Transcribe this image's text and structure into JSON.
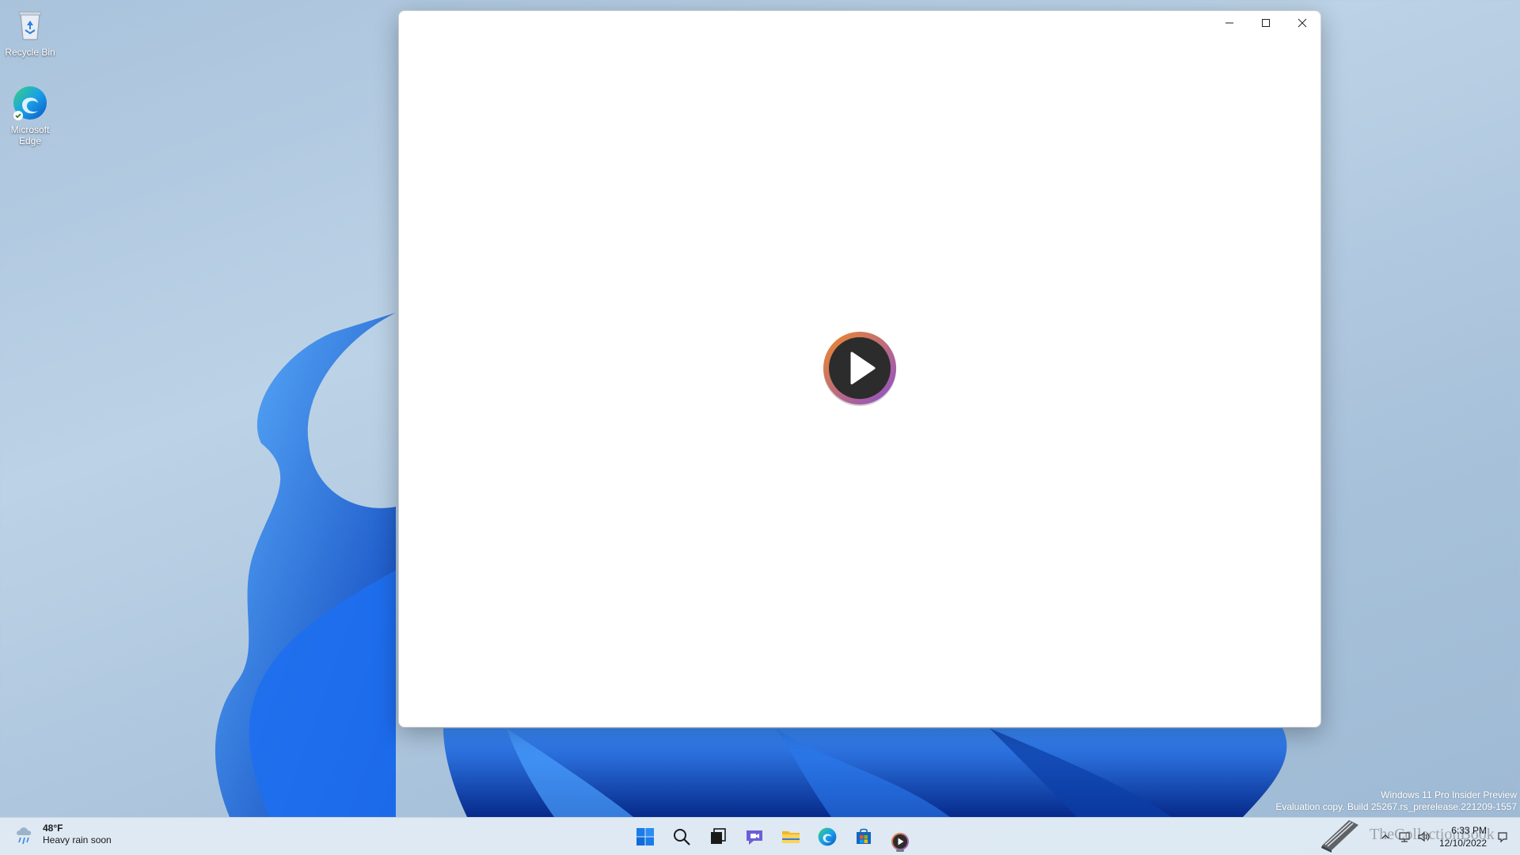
{
  "desktop": {
    "icons": [
      {
        "label": "Recycle Bin",
        "icon": "recycle-bin-icon"
      },
      {
        "label": "Microsoft Edge",
        "icon": "edge-icon"
      }
    ]
  },
  "window": {
    "controls": {
      "minimize": "minimize-icon",
      "maximize": "maximize-icon",
      "close": "close-icon"
    },
    "logo": "play-logo-icon"
  },
  "watermark": {
    "line1": "Windows 11 Pro Insider Preview",
    "line2": "Evaluation copy. Build 25267.rs_prerelease.221209-1557"
  },
  "taskbar": {
    "weather": {
      "temp": "48°F",
      "condition": "Heavy rain soon",
      "icon": "rain-cloud-icon"
    },
    "pinned": [
      {
        "name": "start",
        "icon": "windows-start-icon"
      },
      {
        "name": "search",
        "icon": "search-icon"
      },
      {
        "name": "task-view",
        "icon": "task-view-icon"
      },
      {
        "name": "chat",
        "icon": "chat-icon"
      },
      {
        "name": "file-explorer",
        "icon": "folder-icon"
      },
      {
        "name": "edge",
        "icon": "edge-icon"
      },
      {
        "name": "store",
        "icon": "store-icon"
      },
      {
        "name": "player",
        "icon": "play-icon"
      }
    ],
    "tray": {
      "overflow": "chevron-up-icon",
      "network": "network-icon",
      "volume": "volume-icon",
      "time": "6:33 PM",
      "date": "12/10/2022",
      "notifications": "notification-icon",
      "overlay_text": "TheCollectionBook"
    }
  },
  "colors": {
    "accent": "#0a5bd8",
    "play_ring_start": "#f08a24",
    "play_ring_end": "#8b4fd1"
  }
}
